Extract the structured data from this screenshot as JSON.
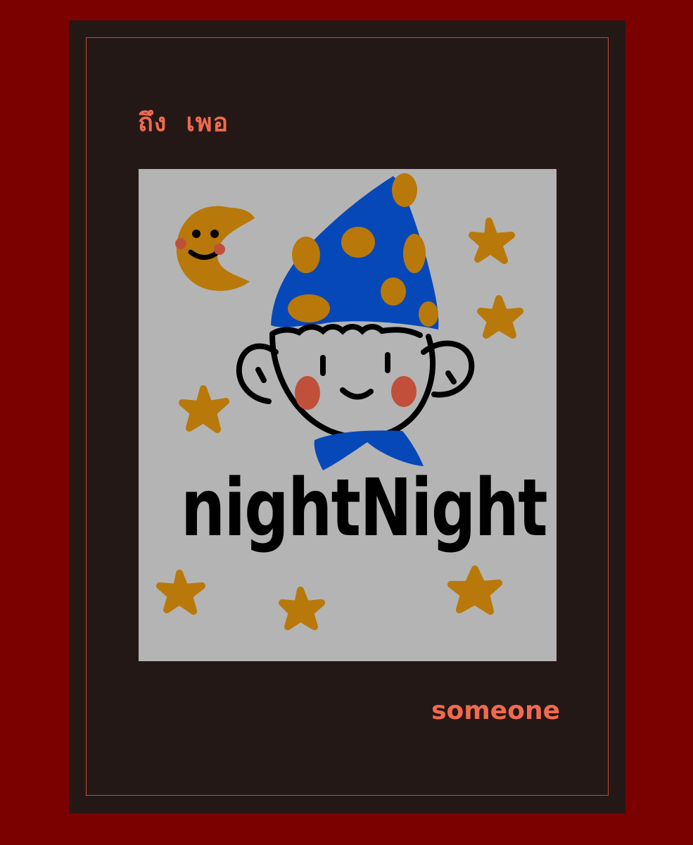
{
  "card": {
    "to_label": "ถึง",
    "to_name": "เพอ",
    "from_name": "someone"
  },
  "drawing": {
    "handwritten_text": "nightNight",
    "icons": [
      "crescent-moon-icon",
      "star-icon",
      "wizard-hat-icon",
      "face-icon",
      "bow-tie-icon"
    ]
  },
  "colors": {
    "background": "#7b0000",
    "card": "#241816",
    "border": "#c84a35",
    "text": "#f06a50",
    "drawing_bg": "#b4b4b4",
    "hat_blue": "#0648b8",
    "mustard": "#b8780a",
    "blush": "#c0503a"
  }
}
